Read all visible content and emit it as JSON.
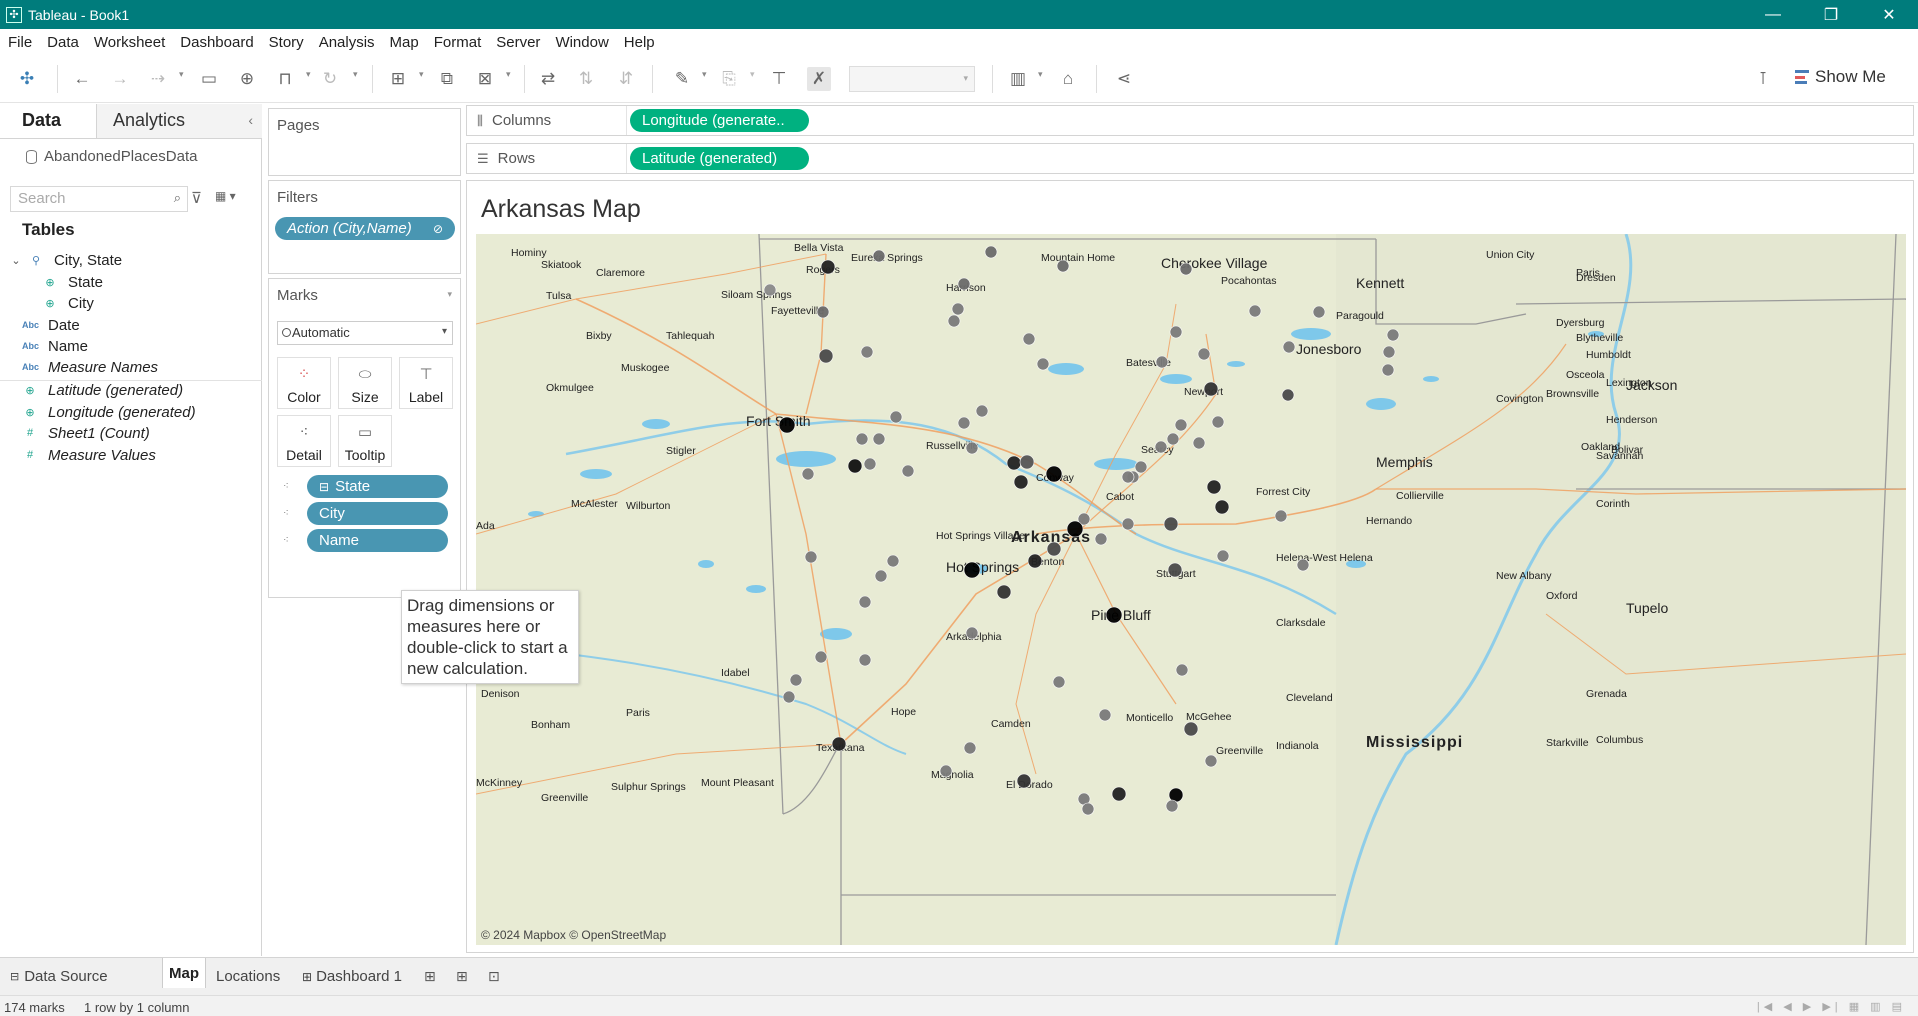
{
  "window": {
    "title": "Tableau - Book1"
  },
  "menu": [
    "File",
    "Data",
    "Worksheet",
    "Dashboard",
    "Story",
    "Analysis",
    "Map",
    "Format",
    "Server",
    "Window",
    "Help"
  ],
  "toolbar": {
    "show_me": "Show Me"
  },
  "data_pane": {
    "tab_data": "Data",
    "tab_analytics": "Analytics",
    "datasource": "AbandonedPlacesData",
    "search_placeholder": "Search",
    "tables_heading": "Tables",
    "fields": [
      {
        "label": "City, State",
        "icon": "hierarchy-icon"
      },
      {
        "label": "State",
        "icon": "globe-icon"
      },
      {
        "label": "City",
        "icon": "globe-icon"
      },
      {
        "label": "Date",
        "icon": "abc-icon"
      },
      {
        "label": "Name",
        "icon": "abc-icon"
      },
      {
        "label": "Measure Names",
        "icon": "abc-icon"
      },
      {
        "label": "Latitude (generated)",
        "icon": "globe-icon"
      },
      {
        "label": "Longitude (generated)",
        "icon": "globe-icon"
      },
      {
        "label": "Sheet1 (Count)",
        "icon": "hash-icon"
      },
      {
        "label": "Measure Values",
        "icon": "hash-icon"
      }
    ]
  },
  "cards": {
    "pages": "Pages",
    "filters": "Filters",
    "filter_pill": "Action (City,Name)",
    "marks": "Marks",
    "mark_type": "Automatic",
    "mark_buttons": [
      "Color",
      "Size",
      "Label",
      "Detail",
      "Tooltip"
    ],
    "mark_pills": [
      "State",
      "City",
      "Name"
    ]
  },
  "shelves": {
    "columns_label": "Columns",
    "columns_pill": "Longitude (generate..",
    "rows_label": "Rows",
    "rows_pill": "Latitude (generated)"
  },
  "viz": {
    "title": "Arkansas Map",
    "attribution": "© 2024 Mapbox © OpenStreetMap",
    "map_labels": [
      "Hominy",
      "Bella Vista",
      "Eureka Springs",
      "Mountain Home",
      "Cherokee Village",
      "Pocahontas",
      "Kennett",
      "Union City",
      "Dresden",
      "Paris",
      "Skiatook",
      "Claremore",
      "Rogers",
      "Harrison",
      "Tulsa",
      "Siloam Springs",
      "Fayetteville",
      "Paragould",
      "Dyersburg",
      "Blytheville",
      "Tahlequah",
      "Jonesboro",
      "Humboldt",
      "Bixby",
      "Batesville",
      "Muskogee",
      "Osceola",
      "Jackson",
      "Okmulgee",
      "Lexington",
      "Covington",
      "Brownsville",
      "Newport",
      "Henderson",
      "Fort Smith",
      "Russellville",
      "Searcy",
      "Memphis",
      "Oakland",
      "Stigler",
      "Bolivar",
      "Savannah",
      "Conway",
      "Cabot",
      "Forrest City",
      "Collierville",
      "McAlester",
      "Wilburton",
      "Corinth",
      "Hernando",
      "Hot Springs Village",
      "Arkansas",
      "Helena-West Helena",
      "Hot Springs",
      "Benton",
      "Stuttgart",
      "New Albany",
      "Oxford",
      "Tupelo",
      "Pine Bluff",
      "Clarksdale",
      "Arkadelphia",
      "Idabel",
      "Denison",
      "Paris",
      "Hope",
      "Cleveland",
      "Grenada",
      "Bonham",
      "Camden",
      "Monticello",
      "McGehee",
      "Greenville",
      "Indianola",
      "Starkville",
      "Columbus",
      "Mississippi",
      "Texarkana",
      "Magnolia",
      "El Dorado",
      "McKinney",
      "Greenville",
      "Sulphur Springs",
      "Mount Pleasant",
      "Ada"
    ]
  },
  "tooltip": {
    "text": "Drag dimensions or measures here or double-click to start a new calculation."
  },
  "bottom_tabs": {
    "data_source": "Data Source",
    "sheets": [
      "Map",
      "Locations"
    ],
    "dashboard": "Dashboard 1"
  },
  "status": {
    "marks": "174 marks",
    "rows_cols": "1 row by 1 column"
  }
}
